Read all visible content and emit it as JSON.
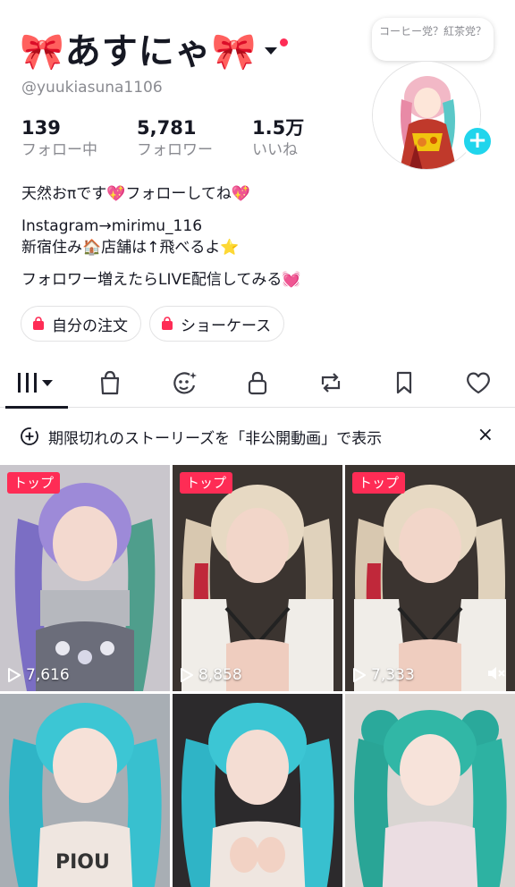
{
  "profile": {
    "display_name": "🎀あすにゃ🎀",
    "handle": "@yuukiasuna1106",
    "note_bubble": "コーヒー党？紅茶党？",
    "stats": [
      {
        "value": "139",
        "label": "フォロー中"
      },
      {
        "value": "5,781",
        "label": "フォロワー"
      },
      {
        "value": "1.5万",
        "label": "いいね"
      }
    ],
    "bio": [
      "天然おπです💖フォローしてね💖",
      "Instagram→mirimu_116",
      "新宿住み🏠店舗は↑飛べるよ⭐",
      "フォロワー増えたらLIVE配信してみる💓"
    ]
  },
  "pills": [
    {
      "label": "自分の注文",
      "icon": "shopping-bag-icon"
    },
    {
      "label": "ショーケース",
      "icon": "shopping-bag-icon"
    }
  ],
  "tabs": [
    {
      "icon": "grid-videos-icon",
      "active": true
    },
    {
      "icon": "shop-bag-icon"
    },
    {
      "icon": "ai-face-icon"
    },
    {
      "icon": "lock-icon"
    },
    {
      "icon": "repost-icon"
    },
    {
      "icon": "bookmark-icon"
    },
    {
      "icon": "heart-icon"
    }
  ],
  "notice": {
    "text": "期限切れのストーリーズを「非公開動画」で表示",
    "close": "×"
  },
  "videos": [
    {
      "badge": "トップ",
      "views": "7,616"
    },
    {
      "badge": "トップ",
      "views": "8,858"
    },
    {
      "badge": "トップ",
      "views": "7,333",
      "muted": true
    },
    {
      "badge": "",
      "views": ""
    },
    {
      "badge": "",
      "views": ""
    },
    {
      "badge": "",
      "views": ""
    }
  ],
  "colors": {
    "accent_red": "#fe2c55",
    "accent_cyan": "#20d5ec",
    "text_primary": "#161823",
    "text_secondary": "#8a8b91"
  }
}
